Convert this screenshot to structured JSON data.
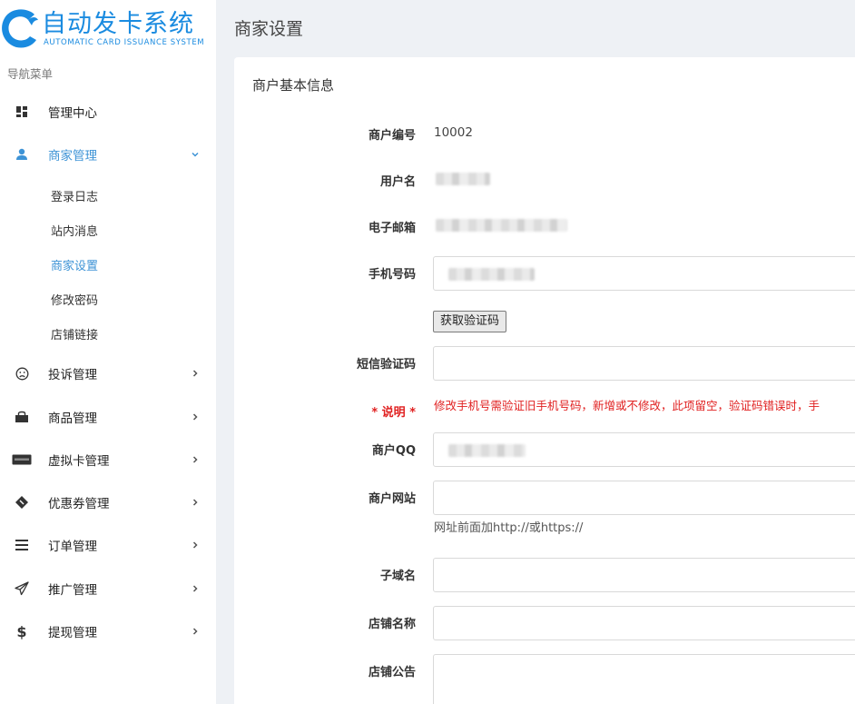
{
  "brand": {
    "title": "自动发卡系统",
    "subtitle": "AUTOMATIC CARD ISSUANCE SYSTEM",
    "color": "#1a8be0"
  },
  "nav": {
    "caption": "导航菜单",
    "items": [
      {
        "label": "管理中心",
        "icon": "dashboard-icon"
      },
      {
        "label": "商家管理",
        "icon": "user-icon",
        "expanded": true
      },
      {
        "label": "投诉管理",
        "icon": "frown-icon"
      },
      {
        "label": "商品管理",
        "icon": "shopping-bag-icon"
      },
      {
        "label": "虚拟卡管理",
        "icon": "card-icon"
      },
      {
        "label": "优惠券管理",
        "icon": "ticket-icon"
      },
      {
        "label": "订单管理",
        "icon": "list-icon"
      },
      {
        "label": "推广管理",
        "icon": "paper-plane-icon"
      },
      {
        "label": "提现管理",
        "icon": "dollar-icon"
      }
    ],
    "sub_items": [
      {
        "label": "登录日志"
      },
      {
        "label": "站内消息"
      },
      {
        "label": "商家设置",
        "active": true
      },
      {
        "label": "修改密码"
      },
      {
        "label": "店铺链接"
      }
    ],
    "active_color": "#3d93d6"
  },
  "header": {
    "title": "商家设置"
  },
  "card": {
    "title": "商户基本信息"
  },
  "form": {
    "merchant_id_label": "商户编号",
    "merchant_id_value": "10002",
    "username_label": "用户名",
    "email_label": "电子邮箱",
    "phone_label": "手机号码",
    "get_code_button": "获取验证码",
    "sms_code_label": "短信验证码",
    "note_label": "* 说明 *",
    "note_text": "修改手机号需验证旧手机号码，新增或不修改，此项留空，验证码错误时，手",
    "qq_label": "商户QQ",
    "website_label": "商户网站",
    "website_help": "网址前面加http://或https://",
    "subdomain_label": "子域名",
    "shop_name_label": "店铺名称",
    "shop_notice_label": "店铺公告"
  },
  "colors": {
    "accent": "#3d93d6",
    "required": "#e02020",
    "background": "#eef1f5"
  }
}
